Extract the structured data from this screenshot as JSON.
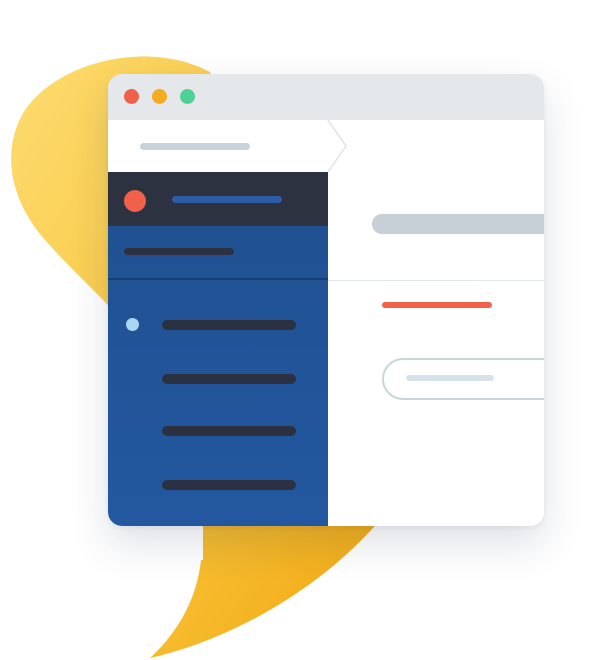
{
  "window": {
    "controls": [
      "close",
      "minimize",
      "maximize"
    ]
  },
  "colors": {
    "close": "#f0604a",
    "minimize": "#f5ac1f",
    "maximize": "#4fd196",
    "blob": "#f8c23a",
    "sidebar_header": "#2d3240",
    "sidebar": "#21549a",
    "placeholder_dark": "#2b3140",
    "placeholder_light": "#c9d2d8",
    "accent_line": "#f0604a",
    "nav_dot": "#a9d6f0"
  },
  "icons": {
    "breadcrumb_separator": "chevron-right-icon",
    "avatar": "avatar-icon"
  }
}
